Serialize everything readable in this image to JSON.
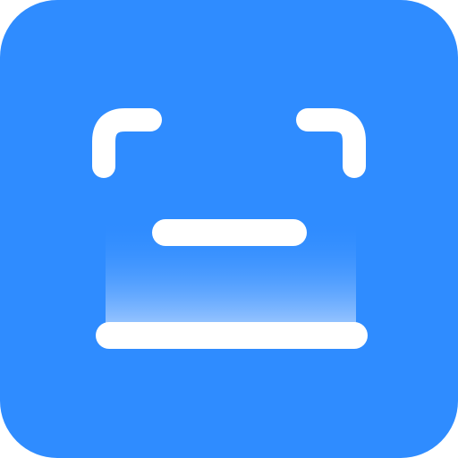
{
  "app_icon": {
    "icon_name": "scanner-icon",
    "background_color": "#2F8CFF",
    "foreground_color": "#FFFFFF",
    "scan_gradient_top_color": "#2F8CFF",
    "scan_gradient_bottom_color": "#A9CEFF"
  }
}
